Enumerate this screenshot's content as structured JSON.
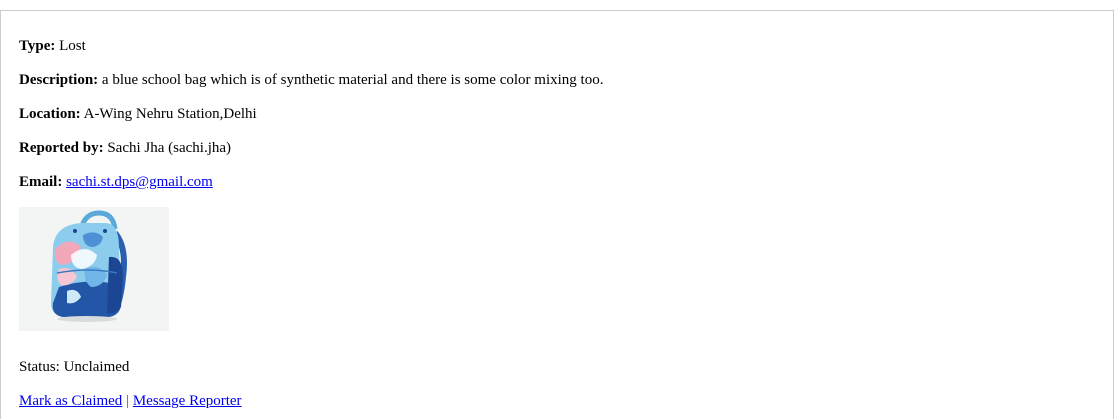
{
  "item": {
    "type_label": "Type:",
    "type_value": "Lost",
    "description_label": "Description:",
    "description_value": "a blue school bag which is of synthetic material and there is some color mixing too.",
    "location_label": "Location:",
    "location_value": "A-Wing Nehru Station,Delhi",
    "reported_label": "Reported by:",
    "reported_value": "Sachi Jha (sachi.jha)",
    "email_label": "Email:",
    "email_value": "sachi.st.dps@gmail.com",
    "status_text": "Status: Unclaimed"
  },
  "actions": {
    "claim_label": "Mark as Claimed",
    "separator": "|",
    "message_label": "Message Reporter"
  },
  "colors": {
    "link": "#0000ee",
    "bag_light_blue": "#7cc3ea",
    "bag_dark_blue": "#1f4fa0",
    "bag_pink": "#f0a3b8"
  },
  "image": {
    "icon": "backpack-image"
  }
}
